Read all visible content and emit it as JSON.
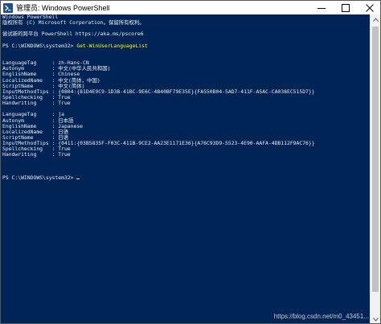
{
  "window": {
    "title": "管理员: Windows PowerShell",
    "colors": {
      "console_background": "#012456",
      "console_text": "#eeedf0",
      "command_text": "#ffff00",
      "titlebar": "#ffffff"
    },
    "icons": {
      "app": "powershell-icon",
      "minimize": "minimize-icon",
      "maximize": "maximize-icon",
      "close": "close-icon"
    }
  },
  "console": {
    "lines": [
      {
        "text": "Windows PowerShell"
      },
      {
        "text": "版权所有 (C) Microsoft Corporation。保留所有权利。"
      },
      {
        "text": ""
      },
      {
        "text": "尝试新的跨平台 PowerShell https://aka.ms/pscore6"
      },
      {
        "text": ""
      },
      {
        "prompt": "PS C:\\WINDOWS\\system32> ",
        "command": "Get-WinUserLanguageList"
      },
      {
        "text": ""
      },
      {
        "text": ""
      },
      {
        "text": "LanguageTag     : zh-Hans-CN"
      },
      {
        "text": "Autonym         : 中文(中华人民共和国)"
      },
      {
        "text": "EnglishName     : Chinese"
      },
      {
        "text": "LocalizedName   : 中文(简体，中国)"
      },
      {
        "text": "ScriptName      : 中文(简体)"
      },
      {
        "text": "InputMethodTips : {0804:{81D4E9C9-1D3B-41BC-9E6C-4B40BF79E35E}{FA550B04-5AD7-411F-A5AC-CA038EC515D7}}"
      },
      {
        "text": "Spellchecking   : True"
      },
      {
        "text": "Handwriting     : True"
      },
      {
        "text": ""
      },
      {
        "text": "LanguageTag     : ja"
      },
      {
        "text": "Autonym         : 日本語"
      },
      {
        "text": "EnglishName     : Japanese"
      },
      {
        "text": "LocalizedName   : 日语"
      },
      {
        "text": "ScriptName      : 日语"
      },
      {
        "text": "InputMethodTips : {0411:{03B5835F-F03C-411B-9CE2-AA23E1171E36}{A76C93D9-5523-4E90-AAFA-4DB112F9AC76}}"
      },
      {
        "text": "Spellchecking   : True"
      },
      {
        "text": "Handwriting     : True"
      },
      {
        "text": ""
      },
      {
        "text": ""
      },
      {
        "text": ""
      },
      {
        "prompt": "PS C:\\WINDOWS\\system32> ",
        "cursor": true
      }
    ]
  },
  "watermark": "https://blog.csdn.net/m0_43451..."
}
